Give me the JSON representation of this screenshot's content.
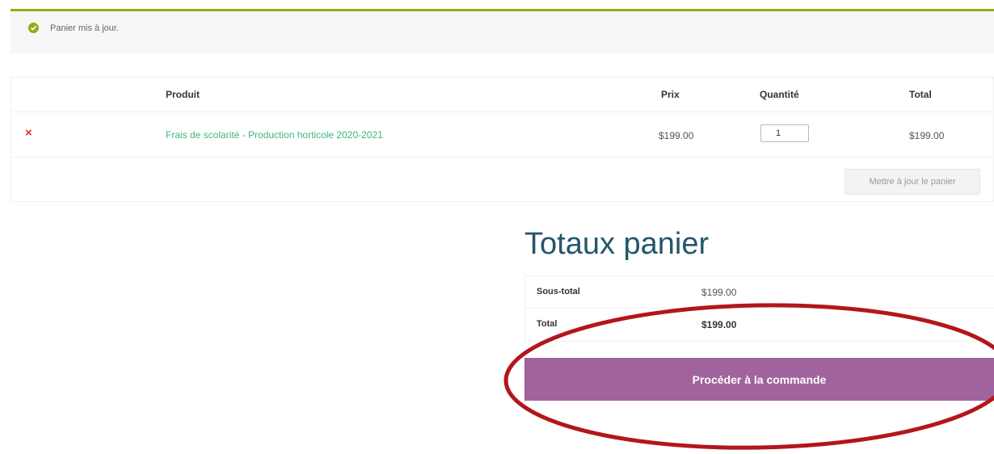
{
  "notice": {
    "text": "Panier mis à jour.",
    "icon": "check-circle-icon",
    "accent_color": "#8fae1b"
  },
  "cart": {
    "columns": {
      "product": "Produit",
      "price": "Prix",
      "quantity": "Quantité",
      "total": "Total"
    },
    "items": [
      {
        "remove_label": "×",
        "name": "Frais de scolarité - Production horticole 2020-2021",
        "price": "$199.00",
        "quantity": "1",
        "total": "$199.00"
      }
    ],
    "update_button": "Mettre à jour le panier"
  },
  "totals": {
    "title": "Totaux panier",
    "subtotal_label": "Sous-total",
    "subtotal_value": "$199.00",
    "total_label": "Total",
    "total_value": "$199.00",
    "checkout_button": "Procéder à la commande"
  },
  "colors": {
    "link": "#3db77a",
    "checkout": "#a0639d",
    "title": "#24566c",
    "annotation": "#b3161b",
    "remove": "#d33333"
  }
}
